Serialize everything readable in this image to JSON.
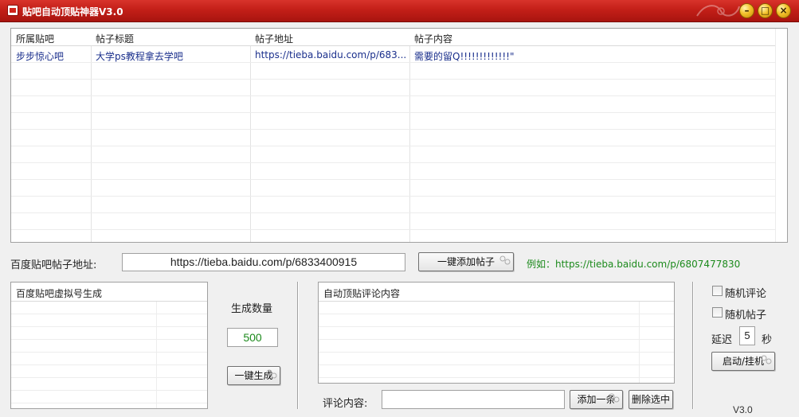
{
  "window": {
    "title": "贴吧自动顶贴神器V3.0",
    "controls": {
      "minimize": "–",
      "maximize": "□",
      "close": "×"
    }
  },
  "grid": {
    "columns": [
      "所属贴吧",
      "帖子标题",
      "帖子地址",
      "帖子内容"
    ],
    "rows": [
      {
        "bar": "步步惊心吧",
        "title": "大学ps教程拿去学吧",
        "url": "https://tieba.baidu.com/p/683...",
        "content": "需要的留Q!!!!!!!!!!!!!\""
      }
    ]
  },
  "url_row": {
    "label": "百度贴吧帖子地址:",
    "value": "https://tieba.baidu.com/p/6833400915",
    "add_button": "一键添加帖子",
    "example": "例如：https://tieba.baidu.com/p/6807477830"
  },
  "virtual_panel": {
    "title": "百度贴吧虚拟号生成"
  },
  "generate": {
    "label": "生成数量",
    "count": "500",
    "button": "一键生成"
  },
  "comment_panel": {
    "title": "自动顶贴评论内容"
  },
  "comment_row": {
    "label": "评论内容:",
    "value": "",
    "add_button": "添加一条",
    "delete_button": "删除选中"
  },
  "options": {
    "random_comment": "随机评论",
    "random_post": "随机帖子",
    "delay_label": "延迟",
    "delay_value": "5",
    "delay_unit": "秒",
    "start_button": "启动/挂机"
  },
  "version": "V3.0",
  "colors": {
    "titlebar": "#c31f18",
    "link_text": "#1a2f8c",
    "example_text": "#1c8a1c"
  },
  "icons": {
    "app": "app-icon",
    "button_deco": "swirl-icon"
  }
}
